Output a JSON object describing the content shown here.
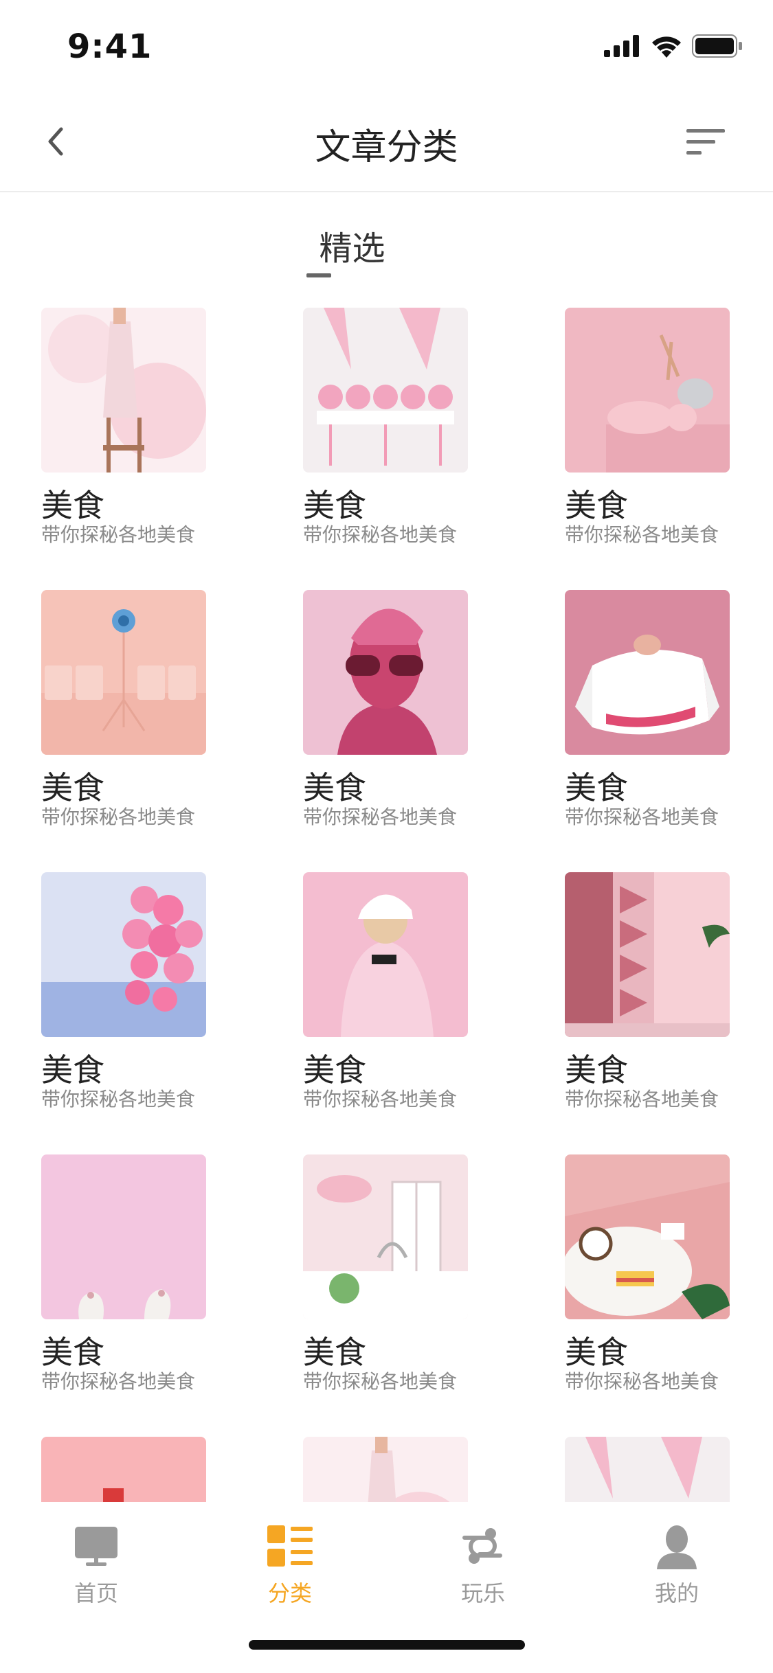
{
  "status_bar": {
    "time": "9:41"
  },
  "nav": {
    "title": "文章分类"
  },
  "section": {
    "label": "精选"
  },
  "cards": [
    {
      "title": "美食",
      "subtitle": "带你探秘各地美食",
      "image": "pink dress on ladder"
    },
    {
      "title": "美食",
      "subtitle": "带你探秘各地美食",
      "image": "pink cake pops"
    },
    {
      "title": "美食",
      "subtitle": "带你探秘各地美食",
      "image": "pink cookware"
    },
    {
      "title": "美食",
      "subtitle": "带你探秘各地美食",
      "image": "speaker and chairs"
    },
    {
      "title": "美食",
      "subtitle": "带你探秘各地美食",
      "image": "man with sunglasses"
    },
    {
      "title": "美食",
      "subtitle": "带你探秘各地美食",
      "image": "sweater with baby oil"
    },
    {
      "title": "美食",
      "subtitle": "带你探秘各地美食",
      "image": "balloons over sea"
    },
    {
      "title": "美食",
      "subtitle": "带你探秘各地美食",
      "image": "person in white cap"
    },
    {
      "title": "美食",
      "subtitle": "带你探秘各地美食",
      "image": "pink shelves room"
    },
    {
      "title": "美食",
      "subtitle": "带你探秘各地美食",
      "image": "cat paws on pink"
    },
    {
      "title": "美食",
      "subtitle": "带你探秘各地美食",
      "image": "pink kitchen"
    },
    {
      "title": "美食",
      "subtitle": "带你探秘各地美食",
      "image": "coconut and cake"
    },
    {
      "title": "",
      "subtitle": "",
      "image": "pink wall"
    },
    {
      "title": "",
      "subtitle": "",
      "image": "pink dress on ladder"
    },
    {
      "title": "",
      "subtitle": "",
      "image": "pink cake pops"
    }
  ],
  "tabbar": {
    "items": [
      {
        "label": "首页",
        "icon": "monitor-icon",
        "active": false
      },
      {
        "label": "分类",
        "icon": "category-list-icon",
        "active": true
      },
      {
        "label": "玩乐",
        "icon": "play-route-icon",
        "active": false
      },
      {
        "label": "我的",
        "icon": "user-profile-icon",
        "active": false
      }
    ]
  },
  "colors": {
    "accent": "#f5a623",
    "inactive": "#9a9a9a"
  }
}
